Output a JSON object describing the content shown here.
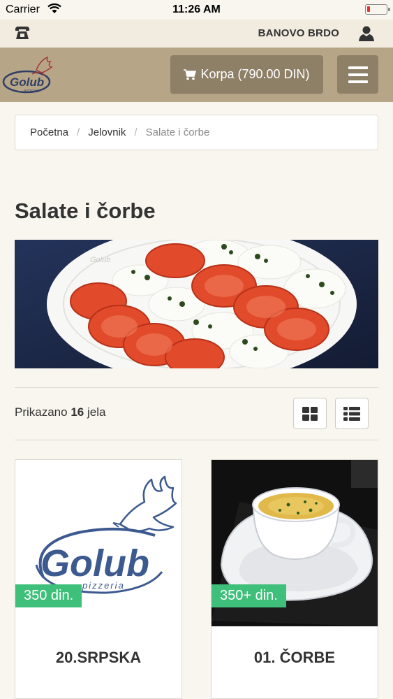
{
  "status_bar": {
    "carrier": "Carrier",
    "time": "11:26 AM"
  },
  "topbar": {
    "location": "BANOVO BRDO"
  },
  "header": {
    "logo_text": "Golub",
    "logo_subtext": "pizzeria",
    "cart_label": "Korpa (790.00 DIN)"
  },
  "breadcrumb": {
    "items": [
      "Početna",
      "Jelovnik",
      "Salate i čorbe"
    ],
    "separator": "/"
  },
  "page_title": "Salate i čorbe",
  "listing": {
    "count_prefix": "Prikazano",
    "count": "16",
    "count_suffix": "jela"
  },
  "products": [
    {
      "name": "20.SRPSKA",
      "price": "350 din.",
      "image": "golub-logo"
    },
    {
      "name": "01. ČORBE",
      "price": "350+ din.",
      "image": "soup-cup"
    }
  ],
  "icons": {
    "phone": "phone-icon",
    "user": "user-icon",
    "cart": "cart-icon",
    "menu": "hamburger-icon",
    "grid": "grid-view-icon",
    "list": "list-view-icon"
  },
  "colors": {
    "header_bg": "#b7a587",
    "button_bg": "#8e7f67",
    "topbar_bg": "#f1ecdf",
    "page_bg": "#f8f6ef",
    "price_badge": "#3fc07a",
    "logo_blue": "#3c5a8f"
  }
}
